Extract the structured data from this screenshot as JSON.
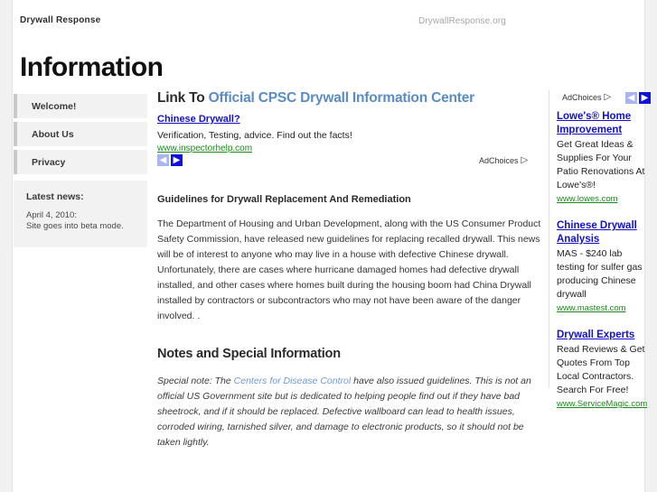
{
  "page": {
    "brand": "Drywall Response",
    "site_url": "DrywallResponse.org",
    "title": "Information"
  },
  "sidebar": {
    "items": [
      {
        "label": "Welcome!"
      },
      {
        "label": "About Us"
      },
      {
        "label": "Privacy"
      }
    ],
    "news": {
      "heading": "Latest news:",
      "date": "April 4, 2010:",
      "text": "Site goes into beta mode."
    }
  },
  "main": {
    "heading_prefix": "Link To ",
    "heading_link": "Official CPSC Drywall Information Center",
    "inline_ad": {
      "title": "Chinese Drywall?",
      "description": "Verification, Testing, advice. Find out the facts!",
      "url": "www.inspectorhelp.com",
      "prev_icon": "chevron-left-icon",
      "next_icon": "chevron-right-icon",
      "adchoices_label": "AdChoices",
      "adchoices_icon": "adchoices-triangle-icon"
    },
    "guidelines_heading": "Guidelines for Drywall Replacement And Remediation",
    "guidelines_body": "The Department of Housing and Urban Development, along with the US Consumer Product Safety Commission, have released new guidelines for replacing recalled drywall. This news will be of interest to anyone who may live in a house with defective Chinese drywall. Unfortunately, there are cases where hurricane damaged homes had defective drywall installed, and other cases where homes built during the housing boom had China Drywall installed by contractors or subcontractors who may not have been aware of the danger involved. .",
    "notes_heading": "Notes and Special Information",
    "notes": {
      "part1": "Special note: The ",
      "link": "Centers for Disease Control",
      "part2": " have also issued guidelines. This is not an official US Government site but is dedicated to helping people find out if they have bad sheetrock, and if it should be replaced. Defective wallboard can lead to health issues, corroded wiring, tarnished silver, and damage to electronic products, so it should not be taken lightly."
    }
  },
  "rail": {
    "adchoices_label": "AdChoices",
    "adchoices_icon": "adchoices-triangle-icon",
    "prev_icon": "chevron-left-icon",
    "next_icon": "chevron-right-icon",
    "ads": [
      {
        "title": "Lowe's® Home Improvement",
        "description": "Get Great Ideas & Supplies For Your Patio Renovations At Lowe's®!",
        "url": "www.lowes.com"
      },
      {
        "title": "Chinese Drywall Analysis",
        "description": "MAS - $240 lab testing for sulfer gas producing Chinese drywall",
        "url": "www.mastest.com"
      },
      {
        "title": "Drywall Experts",
        "description": "Read Reviews & Get Quotes From Top Local Contractors. Search For Free!",
        "url": "www.ServiceMagic.com"
      }
    ]
  },
  "colors": {
    "link_blue": "#1111cc",
    "heading_accent": "#5a8cc4",
    "ad_url_green": "#1a8a1a",
    "sidebar_bg": "#f2f2f2"
  }
}
